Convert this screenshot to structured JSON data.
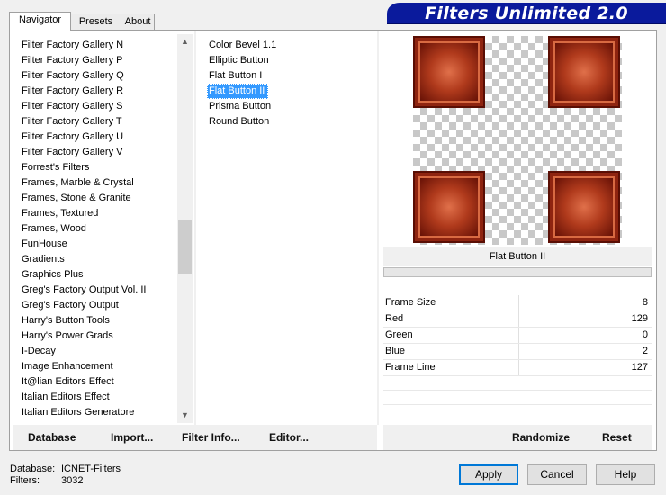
{
  "tabs": [
    {
      "label": "Navigator",
      "active": true
    },
    {
      "label": "Presets",
      "active": false
    },
    {
      "label": "About",
      "active": false
    }
  ],
  "banner": {
    "title": "Filters Unlimited 2.0"
  },
  "categories": [
    "Filter Factory Gallery N",
    "Filter Factory Gallery P",
    "Filter Factory Gallery Q",
    "Filter Factory Gallery R",
    "Filter Factory Gallery S",
    "Filter Factory Gallery T",
    "Filter Factory Gallery U",
    "Filter Factory Gallery V",
    "Forrest's Filters",
    "Frames, Marble & Crystal",
    "Frames, Stone & Granite",
    "Frames, Textured",
    "Frames, Wood",
    "FunHouse",
    "Gradients",
    "Graphics Plus",
    "Greg's Factory Output Vol. II",
    "Greg's Factory Output",
    "Harry's Button Tools",
    "Harry's Power Grads",
    "I-Decay",
    "Image Enhancement",
    "It@lian Editors Effect",
    "Italian Editors Effect",
    "Italian Editors Generatore"
  ],
  "filters": [
    {
      "label": "Color Bevel 1.1",
      "selected": false
    },
    {
      "label": "Elliptic Button",
      "selected": false
    },
    {
      "label": "Flat Button I",
      "selected": false
    },
    {
      "label": "Flat Button II",
      "selected": true
    },
    {
      "label": "Prisma Button",
      "selected": false
    },
    {
      "label": "Round Button",
      "selected": false
    }
  ],
  "preview": {
    "title": "Flat Button II"
  },
  "params": [
    {
      "label": "Frame Size",
      "value": "8",
      "level": 8
    },
    {
      "label": "Red",
      "value": "129",
      "level": 129
    },
    {
      "label": "Green",
      "value": "0",
      "level": 0
    },
    {
      "label": "Blue",
      "value": "2",
      "level": 2
    },
    {
      "label": "Frame Line",
      "value": "127",
      "level": 127
    }
  ],
  "left_buttons": {
    "database": "Database",
    "import": "Import...",
    "filter_info": "Filter Info...",
    "editor": "Editor..."
  },
  "right_buttons": {
    "randomize": "Randomize",
    "reset": "Reset"
  },
  "status": {
    "database_label": "Database:",
    "database_value": "ICNET-Filters",
    "filters_label": "Filters:",
    "filters_value": "3032"
  },
  "dialog_buttons": {
    "apply": "Apply",
    "cancel": "Cancel",
    "help": "Help"
  },
  "colors": {
    "banner": "#0a1a9c",
    "selection": "#3399ff"
  }
}
